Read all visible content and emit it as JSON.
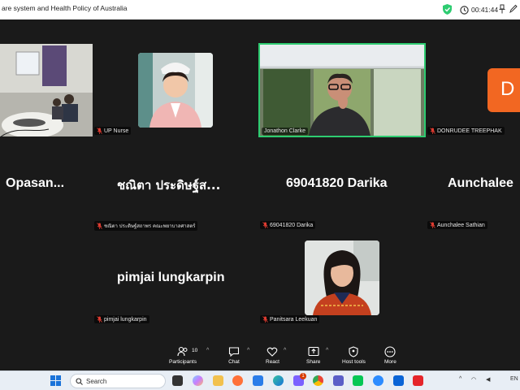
{
  "window": {
    "title": "are system and Health Policy of Australia",
    "timer": "00:41:44"
  },
  "tiles": {
    "t1": {
      "name": ""
    },
    "t2": {
      "name": "UP Nurse"
    },
    "t3": {
      "name": "Jonathon Clarke"
    },
    "t4": {
      "name": "DONRUDEE TREEPHAK",
      "initial": "D"
    },
    "t5": {
      "big": "Opasan...",
      "name": ""
    },
    "t6": {
      "big": "ชณิตา ประดิษฐ์ส...",
      "name": "ชณิตา ประดิษฐ์สถาพร คณะพยาบาลศาสตร์"
    },
    "t7": {
      "big": "69041820 Darika",
      "name": "69041820 Darika"
    },
    "t8": {
      "big": "Aunchalee",
      "name": "Aunchalee Sathian"
    },
    "t9": {
      "big": "pimjai lungkarpin",
      "name": "pimjai lungkarpin"
    },
    "t10": {
      "name": "Panitsara Leekuan"
    }
  },
  "toolbar": {
    "participants_label": "Participants",
    "participants_count": "10",
    "chat_label": "Chat",
    "react_label": "React",
    "share_label": "Share",
    "host_tools_label": "Host tools",
    "more_label": "More"
  },
  "taskbar": {
    "search_placeholder": "Search",
    "language": "EN",
    "chat_badge": "1"
  },
  "colors": {
    "active_speaker": "#2ecc71",
    "avatar_bg": "#f26722",
    "muted_mic": "#e03c31"
  }
}
